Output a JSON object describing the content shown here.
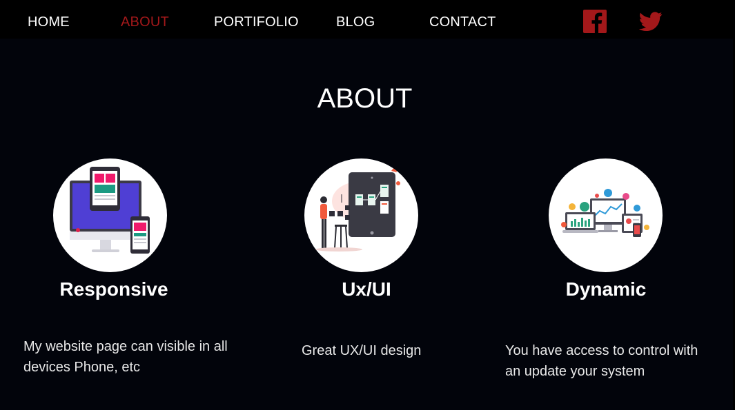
{
  "nav": {
    "items": [
      {
        "label": "HOME",
        "active": false
      },
      {
        "label": "ABOUT",
        "active": true
      },
      {
        "label": "PORTIFOLIO",
        "active": false
      },
      {
        "label": "BLOG",
        "active": false
      },
      {
        "label": "CONTACT",
        "active": false
      }
    ],
    "social": [
      {
        "icon": "facebook-icon"
      },
      {
        "icon": "twitter-icon"
      }
    ]
  },
  "page": {
    "title": "ABOUT"
  },
  "features": [
    {
      "icon": "responsive-devices-icon",
      "title": "Responsive",
      "description": "My website page can visible in all devices Phone, etc"
    },
    {
      "icon": "ux-ui-design-icon",
      "title": "Ux/UI",
      "description": "Great UX/UI design"
    },
    {
      "icon": "dynamic-dashboard-icon",
      "title": "Dynamic",
      "description": "You have access to control with an update your system"
    }
  ],
  "colors": {
    "accent": "#a3181a",
    "background": "#02040b",
    "nav_background": "#000000",
    "text": "#ffffff"
  }
}
